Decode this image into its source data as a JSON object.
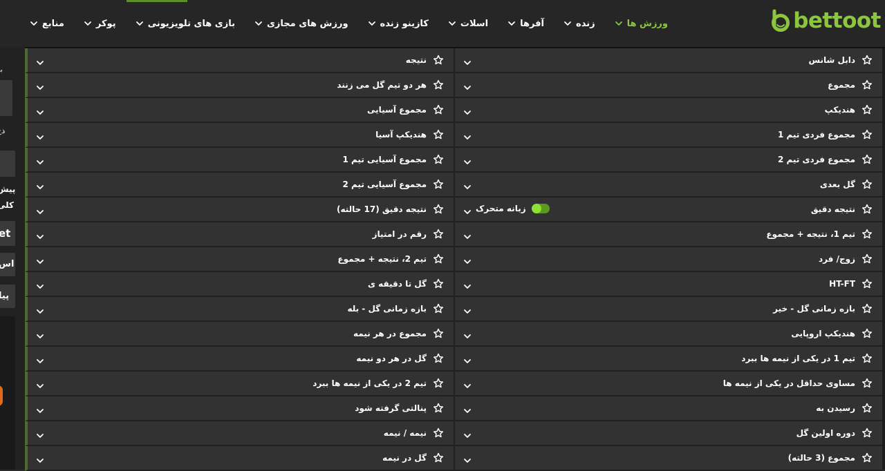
{
  "brand": {
    "name": "bettoot"
  },
  "nav": [
    {
      "label": "ورزش ها",
      "active": true
    },
    {
      "label": "زنده"
    },
    {
      "label": "آفرها"
    },
    {
      "label": "اسلات"
    },
    {
      "label": "کازینو زنده"
    },
    {
      "label": "ورزش های مجازی"
    },
    {
      "label": "بازی های تلویزیونی"
    },
    {
      "label": "پوکر"
    },
    {
      "label": "منابع"
    }
  ],
  "left_sidebar": {
    "snippets": [
      "بر",
      "ذخ",
      "پیش",
      "کلی",
      "et",
      "اس",
      "پیا"
    ]
  },
  "markets_right": [
    "دابل شانس",
    "مجموع",
    "هندیکپ",
    "مجموع فردی تیم 1",
    "مجموع فردی تیم 2",
    "گل بعدی",
    "نتیجه دقیق",
    "تیم 1، نتیجه + مجموع",
    "زوج/ فرد",
    "HT-FT",
    "بازه زمانی گل - خیر",
    "هندیکپ اروپایی",
    "تیم 1 در یکی از نیمه ها ببرد",
    "مساوی حداقل در یکی از نیمه ها",
    "رسیدن به",
    "دوره اولین گل",
    "مجموع (3 حالته)"
  ],
  "markets_left": [
    "نتیجه",
    "هر دو تیم گل می زنند",
    "مجموع آسیایی",
    "هندیکپ آسیا",
    "مجموع آسیایی تیم 1",
    "مجموع آسیایی تیم 2",
    "نتیجه دقیق (17 حالته)",
    "رقم در امتیاز",
    "تیم 2، نتیجه + مجموع",
    "گل تا دقیقه ی",
    "بازه زمانی گل - بله",
    "مجموع در هر نیمه",
    "گل در هر دو نیمه",
    "تیم 2 در یکی از نیمه ها ببرد",
    "پنالتی گرفته شود",
    "نیمه / نیمه",
    "گل در نیمه"
  ],
  "moving_tab_toggle": {
    "label": "زبانه متحرک",
    "on": true,
    "row_index": 6
  },
  "colors": {
    "accent": "#8cc63f",
    "row_bg": "#323232",
    "nav_bg": "#262626"
  }
}
